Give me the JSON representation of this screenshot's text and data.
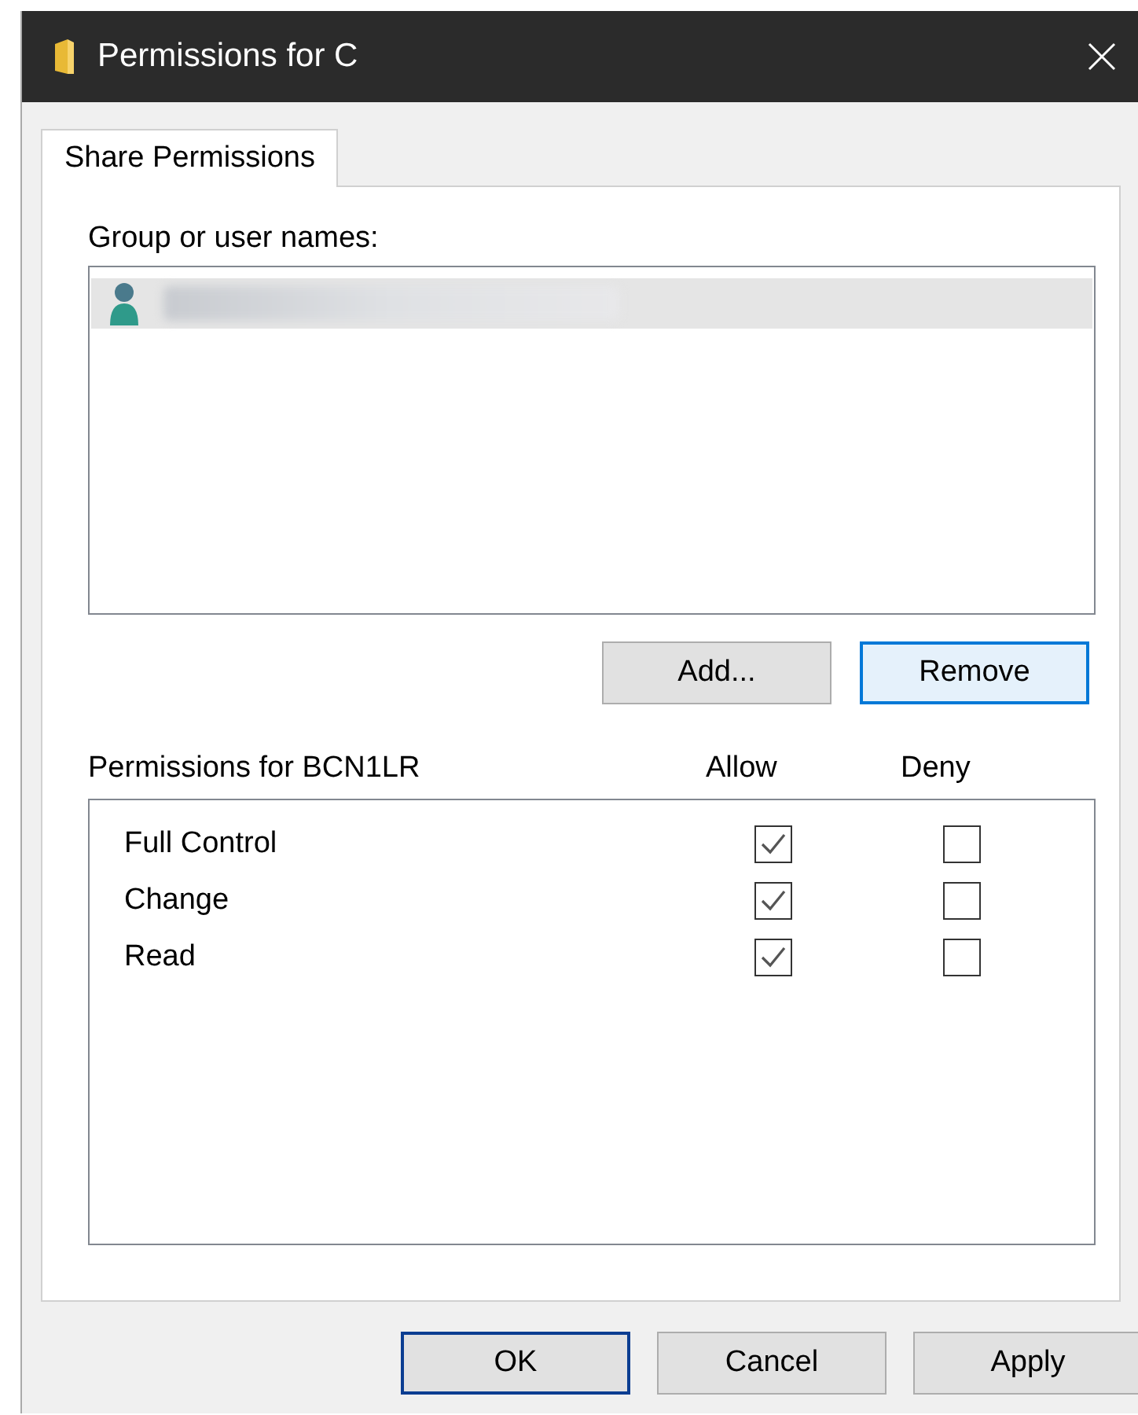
{
  "window": {
    "title": "Permissions for C"
  },
  "tabs": [
    {
      "label": "Share Permissions",
      "selected": true
    }
  ],
  "group_label": "Group or user names:",
  "users": [
    {
      "selected": true
    }
  ],
  "user_buttons": [
    {
      "label": "Add...",
      "focused": false
    },
    {
      "label": "Remove",
      "focused": true
    }
  ],
  "permissions": {
    "label": "Permissions for BCN1LR",
    "columns": [
      "Allow",
      "Deny"
    ],
    "rows": [
      {
        "name": "Full Control",
        "allow": true,
        "deny": false
      },
      {
        "name": "Change",
        "allow": true,
        "deny": false
      },
      {
        "name": "Read",
        "allow": true,
        "deny": false
      }
    ]
  },
  "footer_buttons": [
    {
      "label": "OK",
      "default": true
    },
    {
      "label": "Cancel",
      "default": false
    },
    {
      "label": "Apply",
      "default": false
    }
  ]
}
